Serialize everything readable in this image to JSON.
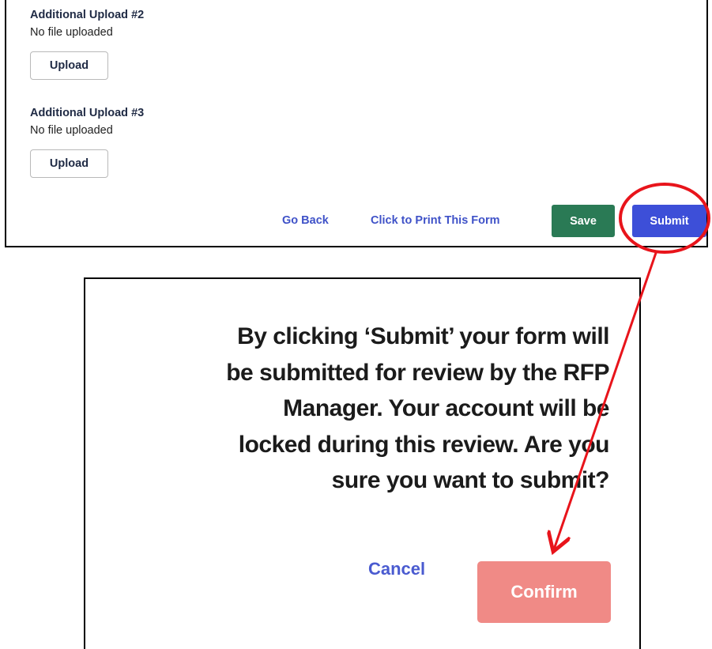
{
  "form": {
    "uploads": [
      {
        "title": "Additional Upload #2",
        "status": "No file uploaded",
        "button_label": "Upload"
      },
      {
        "title": "Additional Upload #3",
        "status": "No file uploaded",
        "button_label": "Upload"
      }
    ],
    "actions": {
      "go_back_label": "Go Back",
      "print_label": "Click to Print This Form",
      "save_label": "Save",
      "submit_label": "Submit"
    }
  },
  "dialog": {
    "message_lines": [
      "By clicking ‘Submit’ your form will",
      "be submitted for review by the RFP",
      "Manager. Your account will be",
      "locked during this review. Are you",
      "sure you want to submit?"
    ],
    "cancel_label": "Cancel",
    "confirm_label": "Confirm"
  },
  "annotation": {
    "highlight_color": "#e8141b"
  },
  "colors": {
    "save_button": "#2a7a55",
    "submit_button": "#3d4fd8",
    "confirm_button": "#f08a86",
    "link": "#3f52c8"
  }
}
